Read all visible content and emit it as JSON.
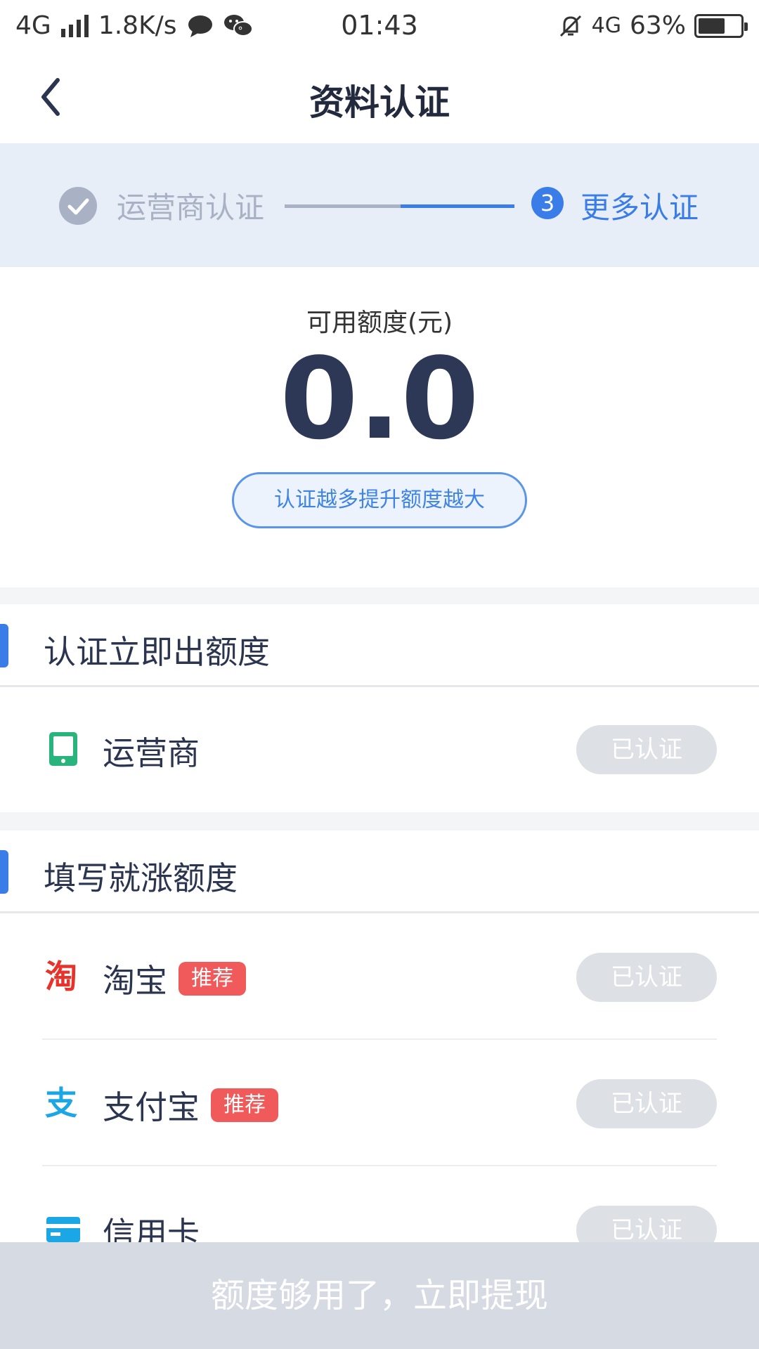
{
  "status_bar": {
    "network_left": "4G",
    "speed": "1.8K/s",
    "time": "01:43",
    "network_right": "4G",
    "battery": "63%",
    "icons": [
      "signal-icon",
      "chat-bubble-icon",
      "wechat-icon",
      "bell-mute-icon",
      "data-arrows-icon",
      "battery-icon"
    ]
  },
  "header": {
    "title": "资料认证"
  },
  "steps": {
    "done_label": "运营商认证",
    "active_number": "3",
    "active_label": "更多认证"
  },
  "quota": {
    "label": "可用额度(元)",
    "value": "0.0",
    "tip": "认证越多提升额度越大"
  },
  "sections": [
    {
      "title": "认证立即出额度",
      "items": [
        {
          "label": "运营商",
          "badge": "",
          "status": "已认证",
          "icon": "phone-icon",
          "color": "#29b47e"
        }
      ]
    },
    {
      "title": "填写就涨额度",
      "items": [
        {
          "label": "淘宝",
          "badge": "推荐",
          "status": "已认证",
          "icon": "taobao-icon",
          "icon_text": "淘",
          "color": "#e8332b"
        },
        {
          "label": "支付宝",
          "badge": "推荐",
          "status": "已认证",
          "icon": "alipay-icon",
          "icon_text": "支",
          "color": "#1ba6e5"
        },
        {
          "label": "信用卡",
          "badge": "",
          "status": "已认证",
          "icon": "credit-card-icon",
          "color": "#1ba6e5"
        }
      ]
    }
  ],
  "bottom_button": "额度够用了，立即提现",
  "colors": {
    "accent": "#3a7de9",
    "step_inactive": "#a9b2c4",
    "badge": "#f15a5a",
    "disabled_button": "#dde0e5"
  }
}
